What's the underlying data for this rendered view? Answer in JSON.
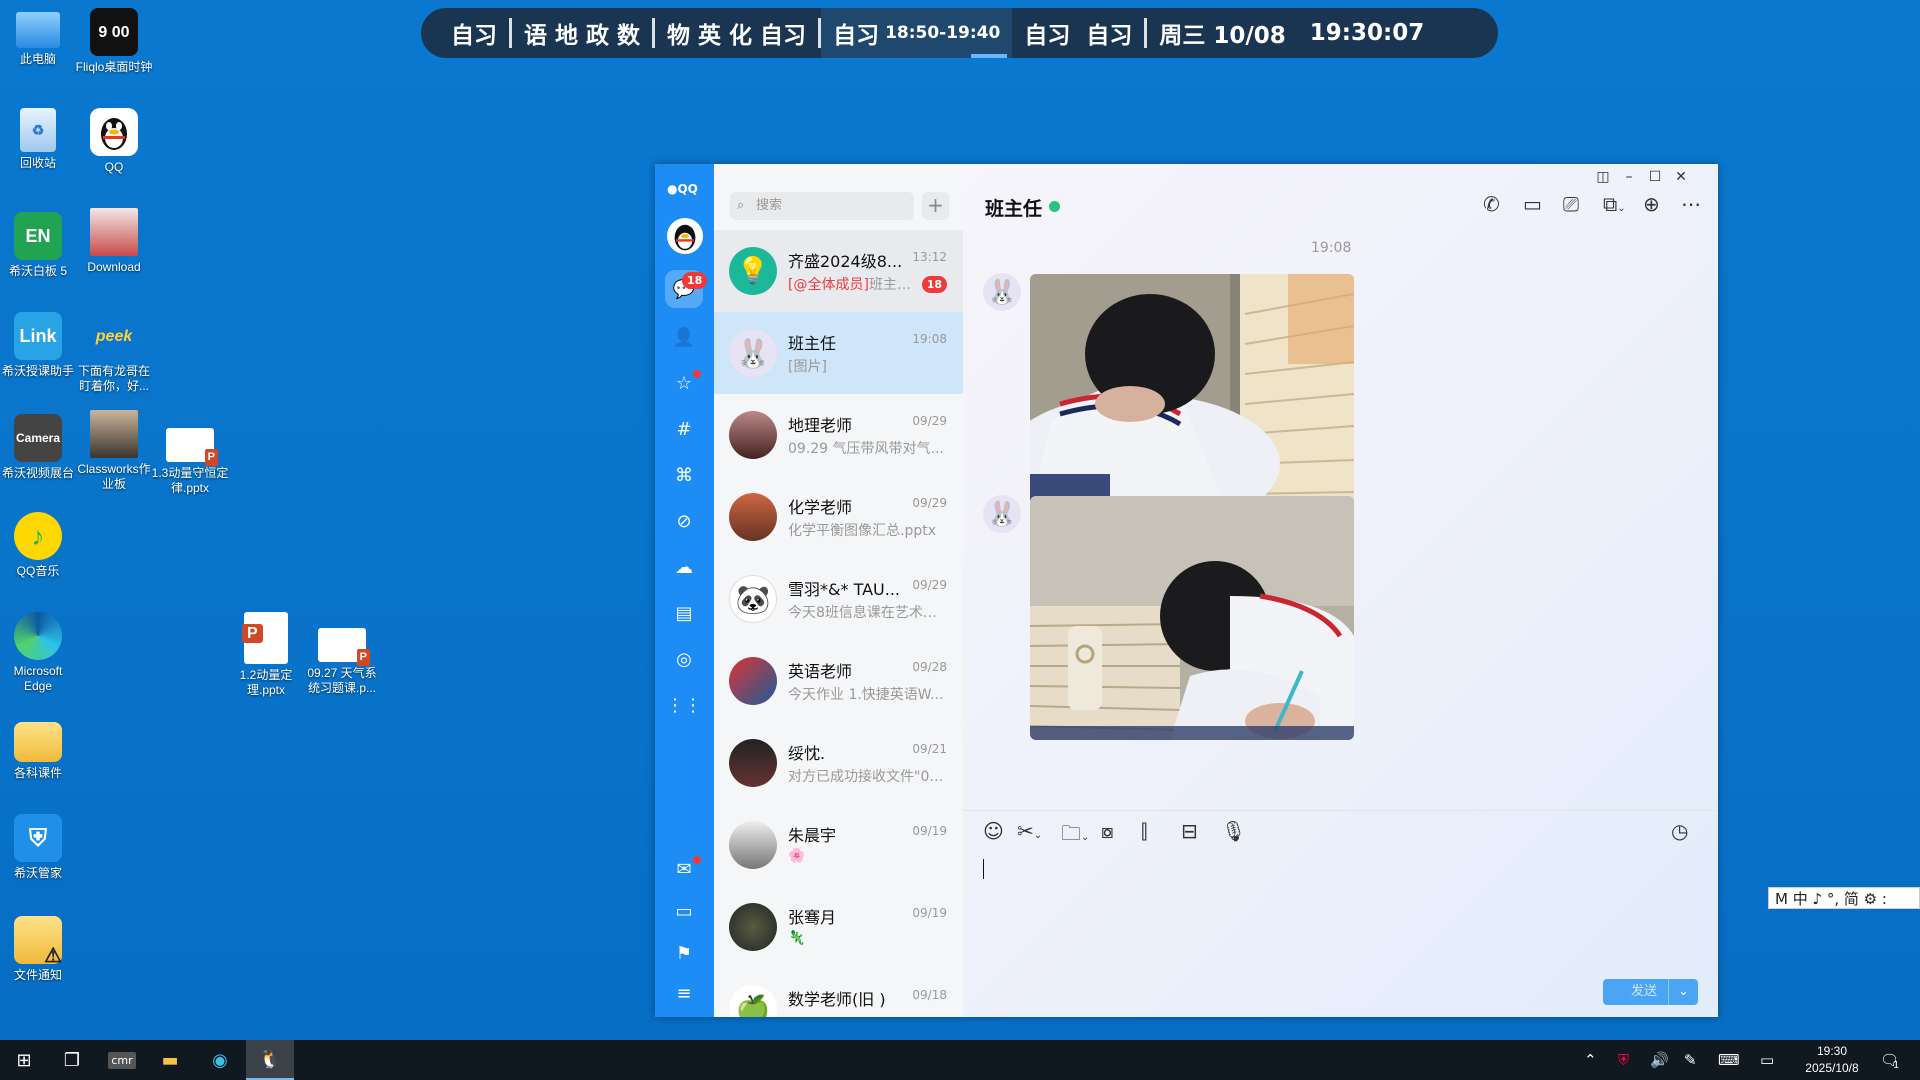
{
  "desktop": {
    "icons": [
      {
        "label": "此电脑"
      },
      {
        "label": "Fliqlo桌面时钟",
        "glyph": "9 00"
      },
      {
        "label": "回收站"
      },
      {
        "label": "QQ"
      },
      {
        "label": "希沃白板 5",
        "glyph": "EN"
      },
      {
        "label": "Download"
      },
      {
        "label": "希沃授课助手",
        "glyph": "Link"
      },
      {
        "label": "下面有龙哥在盯着你，好...",
        "glyph": "peek"
      },
      {
        "label": "希沃视频展台",
        "glyph": "Camera"
      },
      {
        "label": "Classworks作业板"
      },
      {
        "label": "1.3动量守恒定律.pptx"
      },
      {
        "label": "QQ音乐"
      },
      {
        "label": "Microsoft Edge"
      },
      {
        "label": "1.2动量定理.pptx"
      },
      {
        "label": "09.27 天气系统习题课.p..."
      },
      {
        "label": "各科课件"
      },
      {
        "label": "希沃管家"
      },
      {
        "label": "文件通知"
      }
    ]
  },
  "schedule_bar": {
    "segments": [
      "自习",
      "语 地 政 数",
      "物 英 化 自习"
    ],
    "current": {
      "label": "自习",
      "time": "18:50-19:40"
    },
    "next": "自习  自习",
    "date": "周三 10/08",
    "clock": "19:30:07"
  },
  "qq": {
    "rail": {
      "logo": "QQ",
      "messages_badge": "18"
    },
    "search": {
      "placeholder": "搜索"
    },
    "conversations": [
      {
        "name": "齐盛2024级8...",
        "time": "13:12",
        "preview_at": "[@全体成员]",
        "preview": "班主任...",
        "badge": "18"
      },
      {
        "name": "班主任",
        "time": "19:08",
        "preview": "[图片]"
      },
      {
        "name": "地理老师",
        "time": "09/29",
        "preview": "09.29 气压带风带对气..."
      },
      {
        "name": "化学老师",
        "time": "09/29",
        "preview": "化学平衡图像汇总.pptx"
      },
      {
        "name": "雪羽*&* TAU...",
        "time": "09/29",
        "preview": "今天8班信息课在艺术楼..."
      },
      {
        "name": "英语老师",
        "time": "09/28",
        "preview": "今天作业 1.快捷英语W..."
      },
      {
        "name": "绥忱.",
        "time": "09/21",
        "preview": "对方已成功接收文件\"09..."
      },
      {
        "name": "朱晨宇",
        "time": "09/19",
        "preview": ""
      },
      {
        "name": "张骞月",
        "time": "09/19",
        "preview": ""
      },
      {
        "name": "数学老师(旧 )",
        "time": "09/18",
        "preview": ""
      }
    ],
    "chat": {
      "title": "班主任",
      "timestamp": "19:08",
      "send_label": "发送"
    }
  },
  "ime": {
    "text": "M 中 ♪ °, 简 ⚙ :"
  },
  "taskbar": {
    "clock_time": "19:30",
    "clock_date": "2025/10/8",
    "notification_count": "1"
  },
  "colors": {
    "qq_blue": "#1d8cf5",
    "desktop_blue": "#0873c9",
    "online": "#27c47a",
    "badge_red": "#f03a3a"
  }
}
